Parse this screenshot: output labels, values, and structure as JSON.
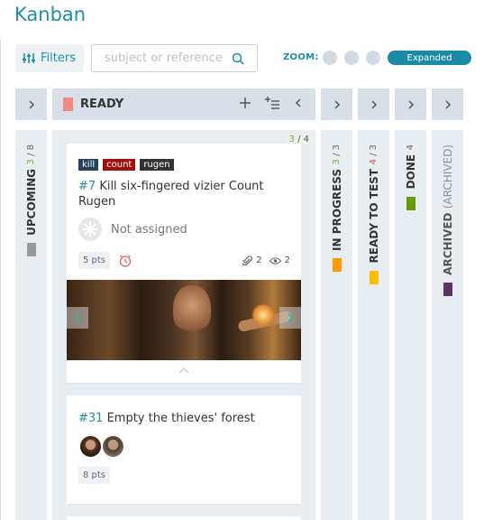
{
  "page_title": "Kanban",
  "filters": {
    "label": "Filters"
  },
  "search": {
    "placeholder": "subject or reference"
  },
  "zoom": {
    "label": "ZOOM:",
    "active_level": "Expanded"
  },
  "columns": {
    "upcoming": {
      "name": "UPCOMING",
      "count_done": "3",
      "count_total": "/ 8",
      "color": "#999999"
    },
    "ready": {
      "name": "READY",
      "color": "#f28b82",
      "wip_current": "3",
      "wip_limit": "/ 4",
      "cards": [
        {
          "tags": [
            {
              "label": "kill",
              "color": "#24425d"
            },
            {
              "label": "count",
              "color": "#a10e0e"
            },
            {
              "label": "rugen",
              "color": "#333333"
            }
          ],
          "ref": "#7",
          "subject": "Kill six-fingered vizier Count Rugen",
          "assignee": "Not assigned",
          "points": "5 pts",
          "attachments": "2",
          "watchers": "2"
        },
        {
          "ref": "#31",
          "subject": "Empty the thieves' forest",
          "points": "8 pts"
        }
      ]
    },
    "in_progress": {
      "name": "IN PROGRESS",
      "count_done": "3",
      "count_total": "/ 3",
      "color": "#ff9900"
    },
    "ready_to_test": {
      "name": "READY TO TEST",
      "count_done": "4",
      "count_total": "/ 3",
      "color": "#fcc000"
    },
    "done": {
      "name": "DONE",
      "count": "4",
      "color": "#669900"
    },
    "archived": {
      "name": "ARCHIVED",
      "suffix": "(ARCHIVED)",
      "color": "#5c3566"
    }
  },
  "icons": {
    "filters": "sliders-icon",
    "search": "search-icon",
    "expand": "chevron-right-icon",
    "collapse": "chevron-left-icon",
    "add": "plus-icon",
    "bulk_add": "list-add-icon",
    "due": "clock-icon",
    "attachment": "paperclip-icon",
    "watchers": "eye-icon"
  },
  "colors": {
    "accent": "#1f8ea8",
    "column_bg": "#e8edf1",
    "header_bg": "#d8dfe6"
  }
}
